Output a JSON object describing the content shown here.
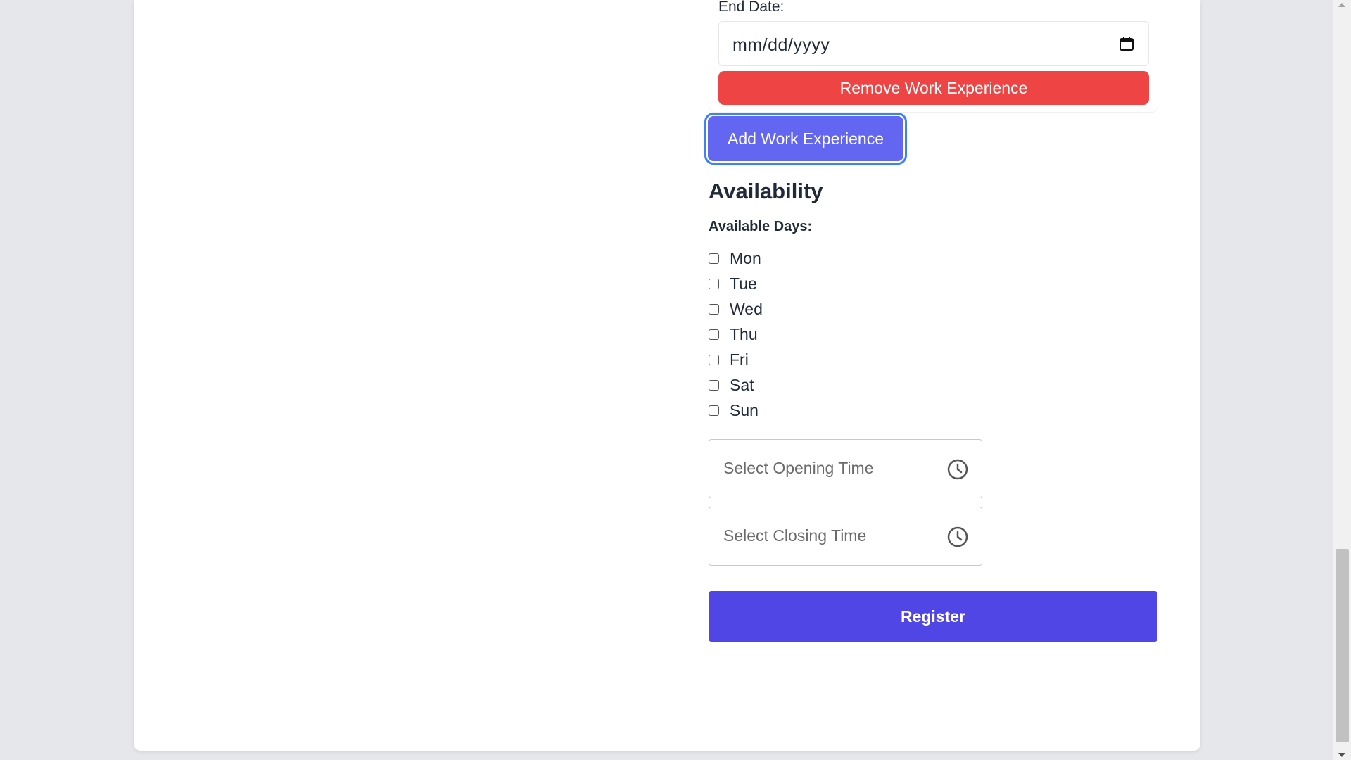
{
  "work_experience": {
    "end_date_label": "End Date:",
    "end_date_value": "mm/dd/yyyy",
    "remove_button": "Remove Work Experience",
    "add_button": "Add Work Experience"
  },
  "availability": {
    "title": "Availability",
    "days_label": "Available Days:",
    "days": [
      {
        "label": "Mon",
        "checked": false
      },
      {
        "label": "Tue",
        "checked": false
      },
      {
        "label": "Wed",
        "checked": false
      },
      {
        "label": "Thu",
        "checked": false
      },
      {
        "label": "Fri",
        "checked": false
      },
      {
        "label": "Sat",
        "checked": false
      },
      {
        "label": "Sun",
        "checked": false
      }
    ],
    "opening_time_placeholder": "Select Opening Time",
    "closing_time_placeholder": "Select Closing Time"
  },
  "register_button": "Register",
  "colors": {
    "remove": "#ef4444",
    "add": "#6366f1",
    "register": "#4f46e5"
  },
  "icons": {
    "date": "calendar-icon",
    "time": "clock-icon"
  }
}
